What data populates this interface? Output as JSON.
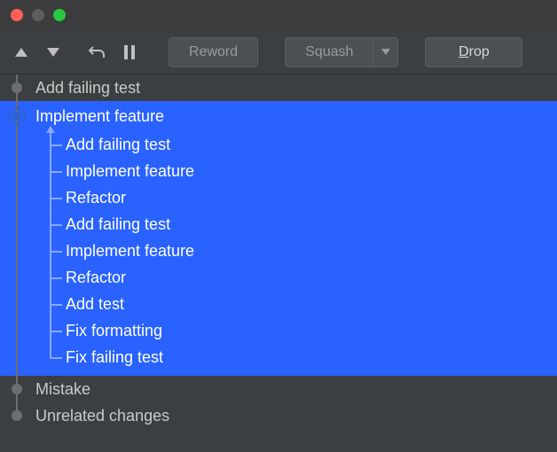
{
  "toolbar": {
    "reword_label": "Reword",
    "squash_label": "Squash",
    "drop_label": "Drop",
    "drop_mnemonic": "D"
  },
  "commits": {
    "before": [
      {
        "label": "Add failing test"
      }
    ],
    "selected": {
      "label": "Implement feature",
      "children": [
        {
          "label": "Add failing test"
        },
        {
          "label": "Implement feature"
        },
        {
          "label": "Refactor"
        },
        {
          "label": "Add failing test"
        },
        {
          "label": "Implement feature"
        },
        {
          "label": "Refactor"
        },
        {
          "label": "Add test"
        },
        {
          "label": "Fix formatting"
        },
        {
          "label": "Fix failing test"
        }
      ]
    },
    "after": [
      {
        "label": "Mistake"
      },
      {
        "label": "Unrelated changes"
      }
    ]
  },
  "colors": {
    "selection": "#2962ff",
    "bg": "#3c3f41"
  }
}
